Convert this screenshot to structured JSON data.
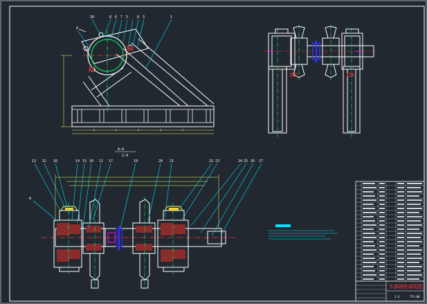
{
  "drawing": {
    "section_label": "A—A",
    "section_scale": "1:4",
    "top_balloons": [
      "20",
      "8",
      "6",
      "7",
      "5",
      "8",
      "3",
      "1"
    ],
    "bottom_balloons_left": [
      "13",
      "12",
      "16",
      "14",
      "15",
      "10",
      "11",
      "17"
    ],
    "bottom_balloons_mid": [
      "19",
      "20",
      "21"
    ],
    "bottom_balloons_right": [
      "22",
      "23",
      "24",
      "25",
      "26",
      "27"
    ],
    "side_mark": "A",
    "side_mark_2": "A"
  },
  "colors": {
    "background": "#212830",
    "frame": "#ffffff",
    "outline": "#ffffff",
    "leader": "#00e5ff",
    "centerline": "#ff3333",
    "dimension": "#ffff66",
    "highlight": "#ff00ff",
    "hatch": "#8b2c2c",
    "hidden": "#3333ff",
    "green": "#00ff66"
  },
  "title_block": {
    "drawing_title": "头部链轮装配图",
    "drawing_number": "TYJ-00",
    "scale": "1:4"
  }
}
